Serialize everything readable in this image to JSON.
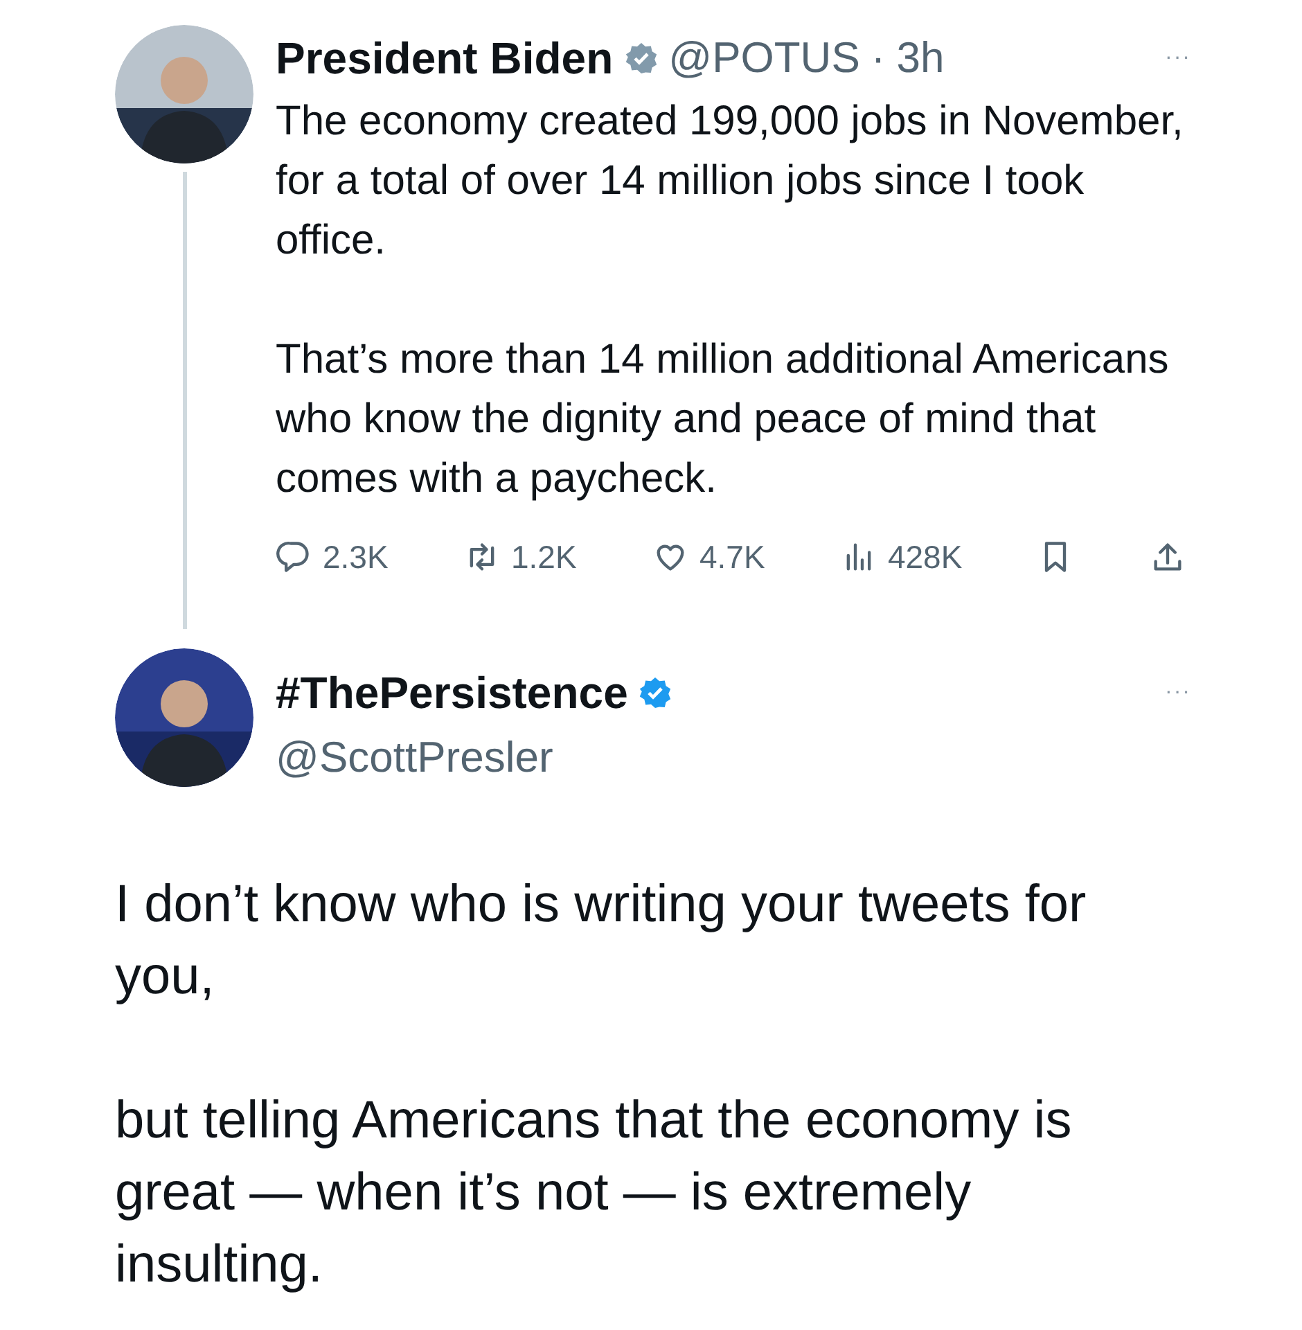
{
  "reply_to": {
    "name": "President Biden",
    "color": "#829aab",
    "handle": "@POTUS",
    "separator": "·",
    "time": "3h",
    "more": "···",
    "paragraphs": [
      "The economy created 199,000 jobs in November, for a total of over 14 million jobs since I took office.",
      "That’s more than 14 million additional Americans who know the dignity and peace of mind that comes with a paycheck."
    ],
    "actions": [
      {
        "kind": "reply",
        "count": "2.3K"
      },
      {
        "kind": "repost",
        "count": "1.2K"
      },
      {
        "kind": "like",
        "count": "4.7K"
      },
      {
        "kind": "views",
        "count": "428K"
      },
      {
        "kind": "bookmark"
      },
      {
        "kind": "share"
      }
    ]
  },
  "post": {
    "name": "#ThePersistence",
    "color": "#1d9bf0",
    "handle": "@ScottPresler",
    "more": "···",
    "paragraphs": [
      "I don’t know who is writing your tweets for you,",
      "but telling Americans that the economy is great — when it’s not — is extremely insulting."
    ]
  }
}
